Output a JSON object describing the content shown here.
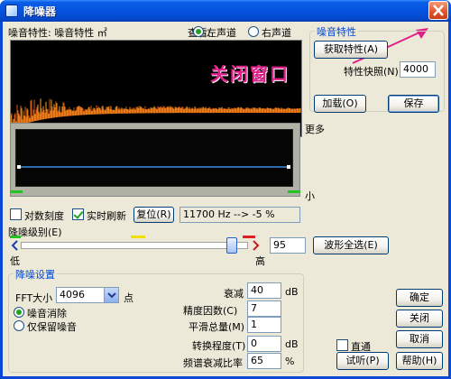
{
  "title": "降噪器",
  "colors": {
    "accent": "#0a46d8",
    "group_title": "#0046d5",
    "annotation": "#e0208a",
    "curve": "#3a8ee6"
  },
  "noise_profile": {
    "label": "噪音特性: 噪音特性 ㎡"
  },
  "view": {
    "label": "查看:",
    "left": "左声道",
    "right": "右声道",
    "selected": "左声道"
  },
  "annotation": "关闭窗口",
  "more_label": "更多",
  "less_label": "小",
  "noise_group": {
    "title": "噪音特性",
    "capture_btn": "获取特性(A)",
    "snapshot_label": "特性快照(N)",
    "snapshot_value": "4000",
    "load_btn": "加载(O)",
    "save_btn": "保存"
  },
  "options": {
    "log_scale": "对数刻度",
    "realtime": "实时刷新",
    "reset_btn": "复位(R)",
    "readout": "11700 Hz --> -5 %",
    "log_scale_checked": false,
    "realtime_checked": true
  },
  "level": {
    "label": "降噪级别(E)",
    "low": "低",
    "high": "高",
    "value": "95",
    "fraction": 0.95,
    "select_all_btn": "波形全选(E)"
  },
  "settings": {
    "title": "降噪设置",
    "fft_label": "FFT大小",
    "fft_value": "4096",
    "fft_unit": "点",
    "mode_remove": "噪音消除",
    "mode_keep": "仅保留噪音",
    "mode_selected": "噪音消除",
    "reduce_label": "衰减",
    "reduce_value": "40",
    "reduce_unit": "dB",
    "precision_label": "精度因数(C)",
    "precision_value": "7",
    "smooth_label": "平滑总量(M)",
    "smooth_value": "1",
    "transition_label": "转换程度(T)",
    "transition_value": "0",
    "transition_unit": "dB",
    "spectral_label": "频谱衰减比率",
    "spectral_value": "65",
    "spectral_unit": "%"
  },
  "buttons": {
    "ok": "确定",
    "close": "关闭",
    "cancel": "取消",
    "bypass": "直通",
    "preview": "试听(P)",
    "help": "帮助(H)"
  }
}
